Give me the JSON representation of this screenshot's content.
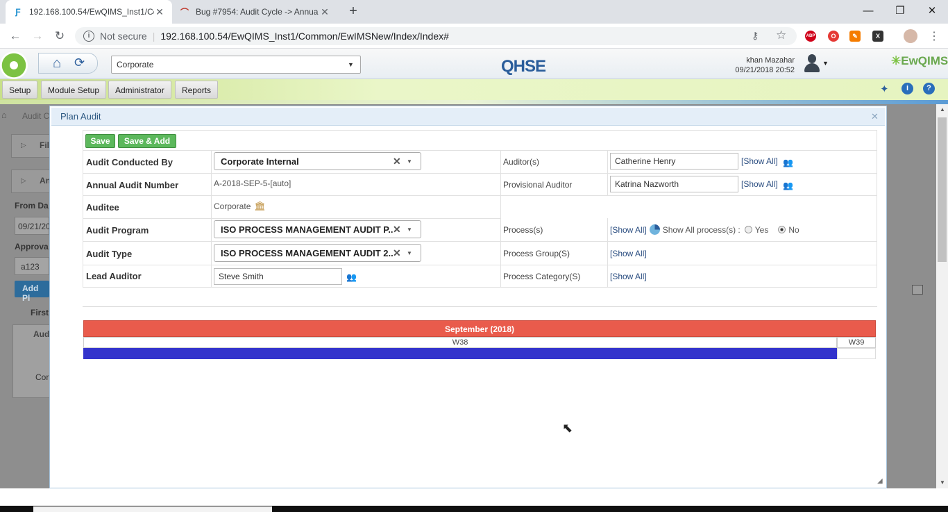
{
  "browser": {
    "tabs": [
      {
        "title": "192.168.100.54/EwQIMS_Inst1/Co",
        "active": true
      },
      {
        "title": "Bug #7954: Audit Cycle -> Annua",
        "active": false
      }
    ],
    "security": "Not secure",
    "url": "192.168.100.54/EwQIMS_Inst1/Common/EwIMSNew/Index/Index#",
    "new_tab": "+",
    "ext_abp": "ABP"
  },
  "header": {
    "site_select": "Corporate",
    "brand": "QHSE",
    "user_name": "khan Mazahar",
    "user_datetime": "09/21/2018 20:52",
    "logo_text": "EwQIMS"
  },
  "menu": [
    "Setup",
    "Module Setup",
    "Administrator",
    "Reports"
  ],
  "background": {
    "breadcrumb": "Audit C",
    "filter": "Fil",
    "annual": "An",
    "from_label": "From Da",
    "from_value": "09/21/20",
    "approval_label": "Approva",
    "approval_value": "a123",
    "add_btn": "Add Pl",
    "first": "First",
    "aud_col": "Aud",
    "corp_cell": "Corp"
  },
  "modal": {
    "title": "Plan Audit",
    "save": "Save",
    "save_add": "Save & Add",
    "fields": {
      "conducted_by_label": "Audit Conducted By",
      "conducted_by_value": "Corporate Internal",
      "annual_no_label": "Annual Audit Number",
      "annual_no_value": "A-2018-SEP-5-[auto]",
      "auditee_label": "Auditee",
      "auditee_value": "Corporate",
      "program_label": "Audit Program",
      "program_value": "ISO PROCESS MANAGEMENT AUDIT P...",
      "type_label": "Audit Type",
      "type_value": "ISO PROCESS MANAGEMENT AUDIT 2...",
      "lead_label": "Lead Auditor",
      "lead_value": "Steve Smith",
      "auditors_label": "Auditor(s)",
      "auditors_value": "Catherine Henry",
      "prov_label": "Provisional Auditor",
      "prov_value": "Katrina Nazworth",
      "process_label": "Process(s)",
      "process_show_all": "Show All process(s) :",
      "yes": "Yes",
      "no": "No",
      "group_label": "Process Group(S)",
      "category_label": "Process Category(S)",
      "show_all": "[Show All]"
    },
    "calendar": {
      "month": "September (2018)",
      "weeks": [
        "W38",
        "W39"
      ],
      "bar_color": "#3333cc",
      "header_color": "#e95b4c"
    }
  }
}
